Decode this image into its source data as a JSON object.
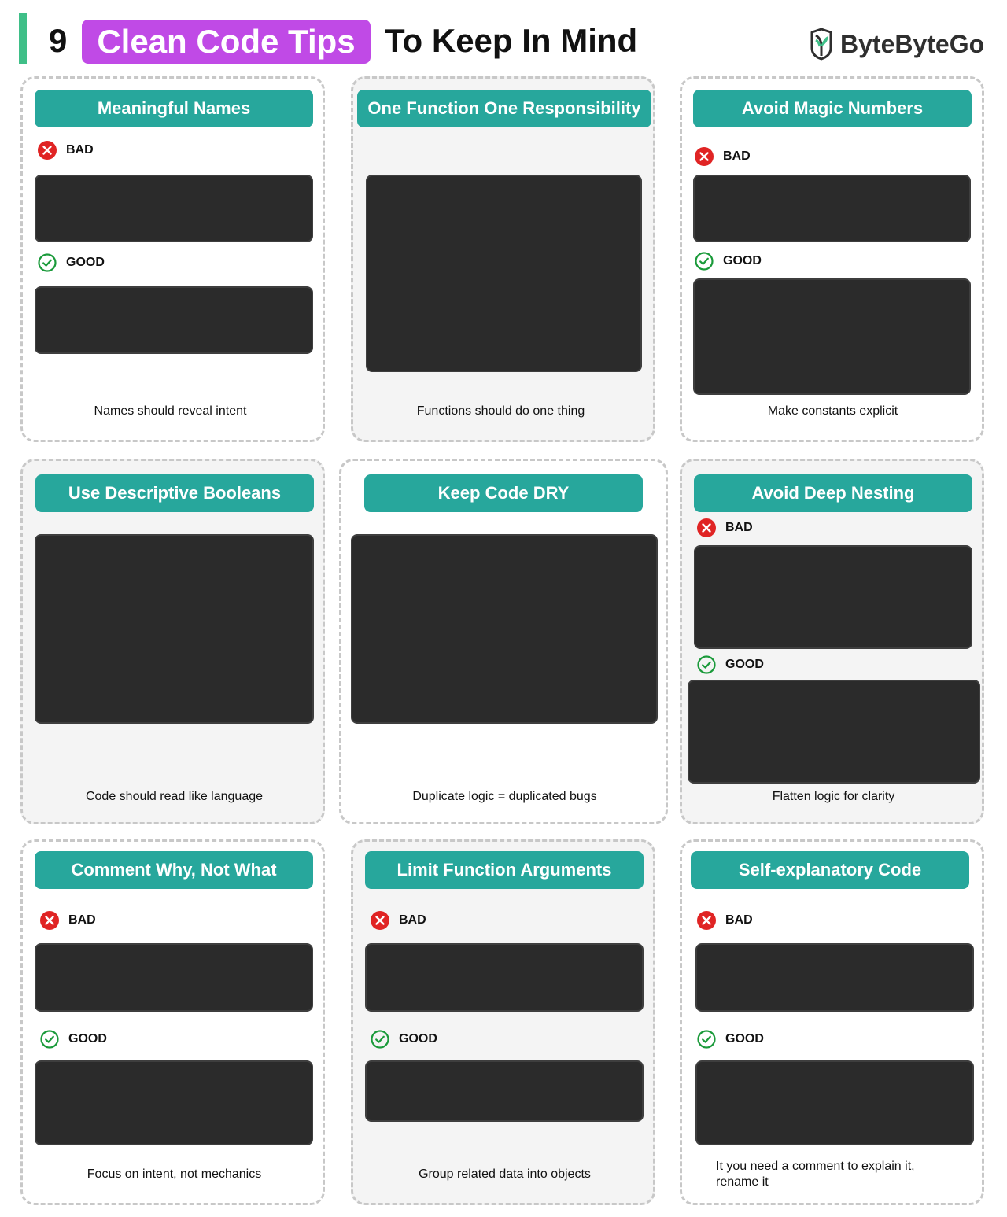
{
  "header": {
    "number": "9",
    "highlight": "Clean Code Tips",
    "rest": "To Keep In Mind",
    "accent_color": "#3fbf88",
    "highlight_color": "#c04ae6"
  },
  "brand": {
    "name": "ByteByteGo",
    "logo_icon": "bytebytego-logo-icon"
  },
  "labels": {
    "bad": "BAD",
    "good": "GOOD"
  },
  "colors": {
    "card_title": "#27a79c",
    "code_block": "#2b2b2b",
    "bad_icon": "#e02424",
    "good_icon": "#1a9a3a"
  },
  "cards": [
    {
      "title": "Meaningful Names",
      "caption": "Names should reveal intent"
    },
    {
      "title": "One Function One Responsibility",
      "caption": "Functions should do one thing"
    },
    {
      "title": "Avoid Magic Numbers",
      "caption": "Make constants explicit"
    },
    {
      "title": "Use Descriptive Booleans",
      "caption": "Code should read like language"
    },
    {
      "title": "Keep Code DRY",
      "caption": "Duplicate logic = duplicated bugs"
    },
    {
      "title": "Avoid Deep Nesting",
      "caption": "Flatten logic for clarity"
    },
    {
      "title": "Comment Why, Not What",
      "caption": "Focus on intent, not mechanics"
    },
    {
      "title": "Limit Function Arguments",
      "caption": "Group related data into objects"
    },
    {
      "title": "Self-explanatory Code",
      "caption": "It you need a comment to explain it, rename it"
    }
  ]
}
